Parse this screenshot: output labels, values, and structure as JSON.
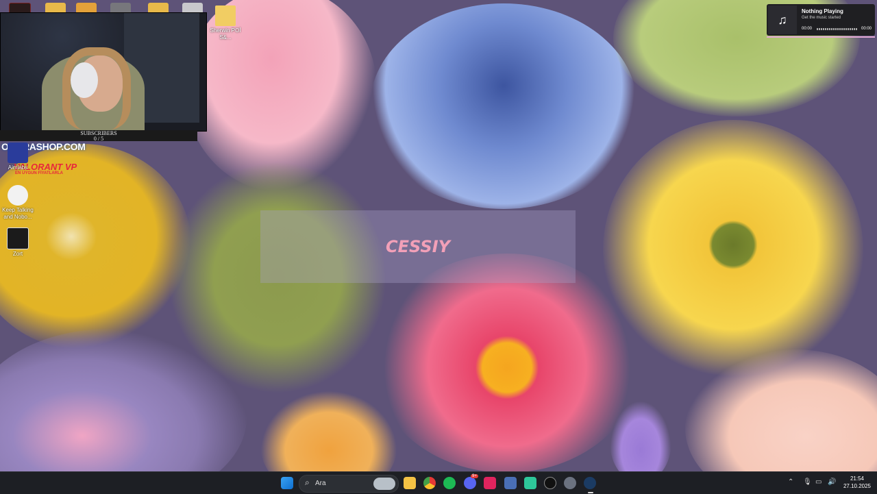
{
  "desktop_icons": [
    {
      "label": "Sherwin POİ̇ S&..."
    },
    {
      "label": "Aimlabs"
    },
    {
      "label": "Keep Talking and Nobo..."
    },
    {
      "label": "Zort"
    }
  ],
  "webcam": {
    "subscribers_label": "SUBSCRIBERS",
    "subscribers_count": "0 / 5"
  },
  "banner": {
    "shop": "OMSRASHOP.COM",
    "valorant": "VALORANT VP",
    "valorant_sub": "EN UYGUN FİYATLARLA"
  },
  "overlay": {
    "text": "CESSIY"
  },
  "now_playing": {
    "title": "Nothing Playing",
    "subtitle": "Get the music started",
    "time_start": "00:00",
    "time_end": "00:00",
    "icon": "music-note-icon"
  },
  "taskbar": {
    "search_placeholder": "Ara",
    "discord_badge": "9+",
    "clock_time": "21:54",
    "clock_date": "27.10.2025"
  },
  "colors": {
    "wallpaper": "#5e5378",
    "taskbar": "#1d1f24",
    "accent_pink": "#e3a8d6"
  }
}
